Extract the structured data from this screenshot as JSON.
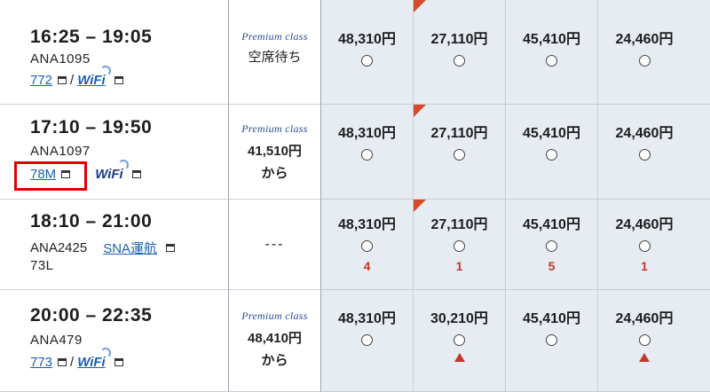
{
  "premium_logo": "Premium class",
  "flights": [
    {
      "time": "16:25 – 19:05",
      "flight_no": "ANA1095",
      "aircraft": "772",
      "separator": "/",
      "wifi": "WiFi",
      "premium": {
        "logo": true,
        "status": "空席待ち",
        "price": "",
        "suffix": ""
      },
      "fares": [
        {
          "price": "48,310円",
          "mark": "",
          "corner": false
        },
        {
          "price": "27,110円",
          "mark": "",
          "corner": true
        },
        {
          "price": "45,410円",
          "mark": "",
          "corner": false
        },
        {
          "price": "24,460円",
          "mark": "",
          "corner": false
        }
      ]
    },
    {
      "time": "17:10 – 19:50",
      "flight_no": "ANA1097",
      "aircraft": "78M",
      "separator": "",
      "wifi": "WiFi",
      "premium": {
        "logo": true,
        "status": "",
        "price": "41,510円",
        "suffix": "から"
      },
      "fares": [
        {
          "price": "48,310円",
          "mark": "",
          "corner": false
        },
        {
          "price": "27,110円",
          "mark": "",
          "corner": true
        },
        {
          "price": "45,410円",
          "mark": "",
          "corner": false
        },
        {
          "price": "24,460円",
          "mark": "",
          "corner": false
        }
      ]
    },
    {
      "time": "18:10 – 21:00",
      "flight_no": "ANA2425",
      "operator": "SNA運航",
      "aircraft": "73L",
      "premium": {
        "logo": false,
        "status": "---",
        "price": "",
        "suffix": ""
      },
      "fares": [
        {
          "price": "48,310円",
          "mark": "4",
          "corner": false
        },
        {
          "price": "27,110円",
          "mark": "1",
          "corner": true
        },
        {
          "price": "45,410円",
          "mark": "5",
          "corner": false
        },
        {
          "price": "24,460円",
          "mark": "1",
          "corner": false
        }
      ]
    },
    {
      "time": "20:00 – 22:35",
      "flight_no": "ANA479",
      "aircraft": "773",
      "separator": "/",
      "wifi": "WiFi",
      "premium": {
        "logo": true,
        "status": "",
        "price": "48,410円",
        "suffix": "から"
      },
      "fares": [
        {
          "price": "48,310円",
          "mark": "",
          "corner": false
        },
        {
          "price": "30,210円",
          "mark": "triangle",
          "corner": false
        },
        {
          "price": "45,410円",
          "mark": "",
          "corner": false
        },
        {
          "price": "24,460円",
          "mark": "triangle",
          "corner": false
        }
      ]
    }
  ]
}
